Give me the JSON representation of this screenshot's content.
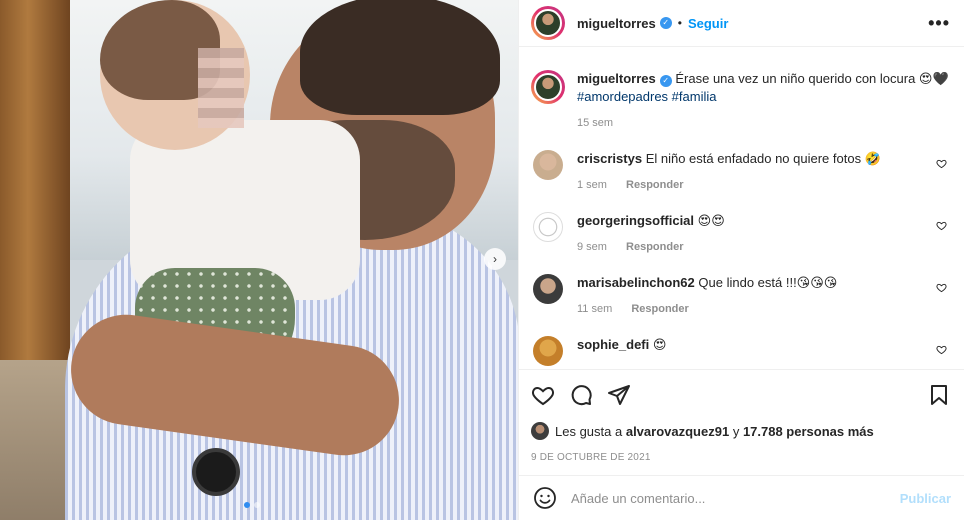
{
  "post": {
    "photo_alt": "photo",
    "carousel_next_icon": "chevron-right-icon",
    "carousel_dots": 2
  },
  "header": {
    "username": "migueltorres",
    "separator": "•",
    "follow_label": "Seguir",
    "more_icon": "more-horizontal-icon"
  },
  "caption": {
    "username": "migueltorres",
    "text": "Érase una vez un niño querido con locura 😍🖤",
    "hashtags": "#amordepadres #familia",
    "time": "15 sem"
  },
  "comments": [
    {
      "username": "criscristys",
      "text": "El niño está enfadado no quiere fotos 🤣",
      "time": "1 sem",
      "reply": "Responder"
    },
    {
      "username": "georgeringsofficial",
      "text": "😍😍",
      "time": "9 sem",
      "reply": "Responder"
    },
    {
      "username": "marisabelinchon62",
      "text": "Que lindo está !!!😘😘😘",
      "time": "11 sem",
      "reply": "Responder"
    },
    {
      "username": "sophie_defi",
      "text": "😍",
      "time": "",
      "reply": ""
    }
  ],
  "likes": {
    "prefix": "Les gusta a",
    "user": "alvarovazquez91",
    "middle": "y",
    "count": "17.788 personas más"
  },
  "date": "9 DE OCTUBRE DE 2021",
  "add_comment": {
    "placeholder": "Añade un comentario...",
    "publish_label": "Publicar",
    "emoji_icon": "smiley-icon"
  },
  "colors": {
    "link_blue": "#0095f6",
    "hashtag": "#00376b",
    "muted": "#8e8e8e",
    "publish_disabled": "#b2dffc"
  }
}
